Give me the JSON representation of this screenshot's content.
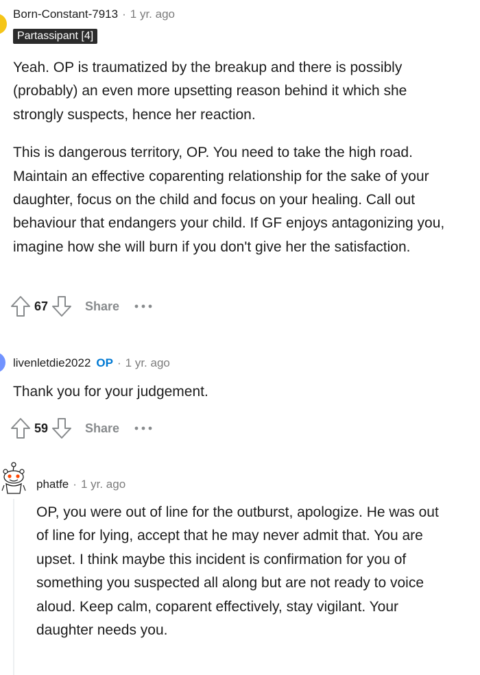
{
  "comments": [
    {
      "username": "Born-Constant-7913",
      "separator": "·",
      "time": "1 yr. ago",
      "flair": "Partassipant [4]",
      "paragraphs": [
        "Yeah. OP is traumatized by the breakup and there is possibly (probably) an even more upsetting reason behind it which she strongly suspects, hence her reaction.",
        "This is dangerous territory, OP. You need to take the high road. Maintain an effective coparenting relationship for the sake of your daughter, focus on the child and focus on your healing. Call out behaviour that endangers your child. If GF enjoys antagonizing you, imagine how she will burn if you don't give her the satisfaction."
      ],
      "score": "67",
      "share_label": "Share",
      "avatar_color": "#f5c518",
      "upvote_icon": "upvote-arrow-icon",
      "downvote_icon": "downvote-arrow-icon",
      "more_icon": "ellipsis-icon"
    },
    {
      "username": "livenletdie2022",
      "op_tag": "OP",
      "separator": "·",
      "time": "1 yr. ago",
      "paragraphs": [
        "Thank you for your judgement."
      ],
      "score": "59",
      "share_label": "Share",
      "avatar_color": "#7193ff"
    },
    {
      "username": "phatfe",
      "separator": "·",
      "time": "1 yr. ago",
      "paragraphs": [
        "OP, you were out of line for the outburst, apologize. He was out of line for lying, accept that he may never admit that. You are upset. I think maybe this incident is confirmation for you of something you suspected all along but are not ready to voice aloud. Keep calm, coparent effectively, stay vigilant. Your daughter needs you."
      ],
      "avatar_icon": "snoo-avatar-icon"
    }
  ],
  "colors": {
    "op_blue": "#0079d3",
    "meta_gray": "#7c7c7c",
    "flair_bg": "#2b2b2b"
  }
}
